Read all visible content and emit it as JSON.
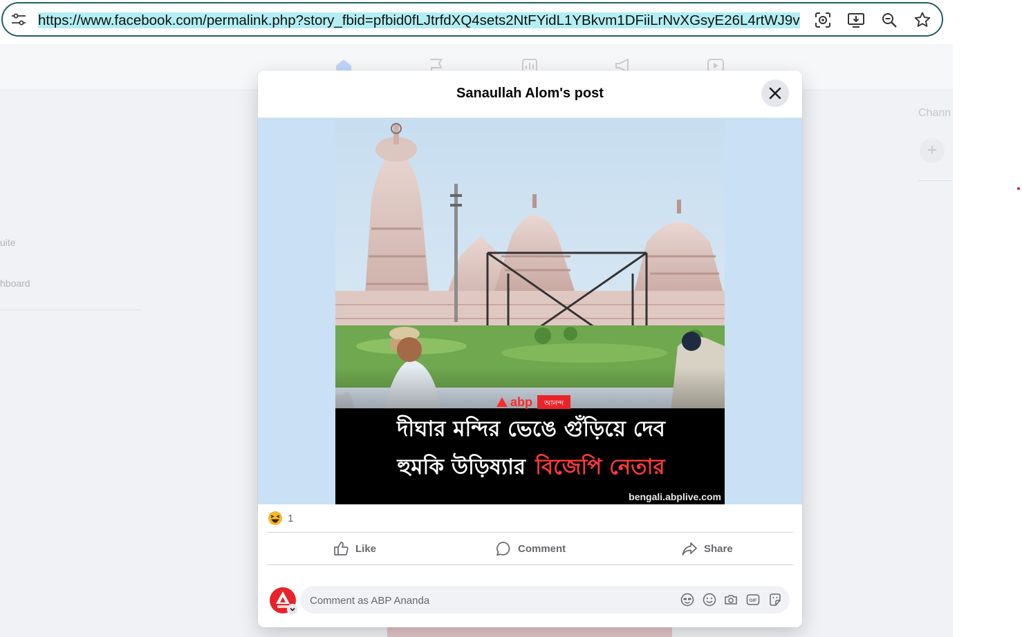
{
  "browser": {
    "url": "https://www.facebook.com/permalink.php?story_fbid=pfbid0fLJtrfdXQ4sets2NtFYidL1YBkvm1DFiiLrNvXGsyE26L4rtWJ9v"
  },
  "background_page": {
    "left_items": [
      "uite",
      "hboard"
    ],
    "right_title": "Chann"
  },
  "modal": {
    "title": "Sanaullah Alom's post",
    "image": {
      "logo_text": "abp",
      "logo_tag": "আনন্দ",
      "headline_line1": "দীঘার মন্দির ভেঙে গুঁড়িয়ে দেব",
      "headline_line2_white": "হুমকি উড়িষ্যার",
      "headline_line2_red": "বিজেপি নেতার",
      "watermark": "bengali.abplive.com"
    },
    "reactions": {
      "count": "1"
    },
    "actions": {
      "like": "Like",
      "comment": "Comment",
      "share": "Share"
    },
    "comment_box": {
      "placeholder": "Comment as ABP Ananda"
    }
  },
  "colors": {
    "url_border": "#1f5e5e",
    "url_highlight": "#b3eef2",
    "brand_red": "#e8232a",
    "headline_red": "#ff3b3b",
    "text_secondary": "#65676b"
  }
}
